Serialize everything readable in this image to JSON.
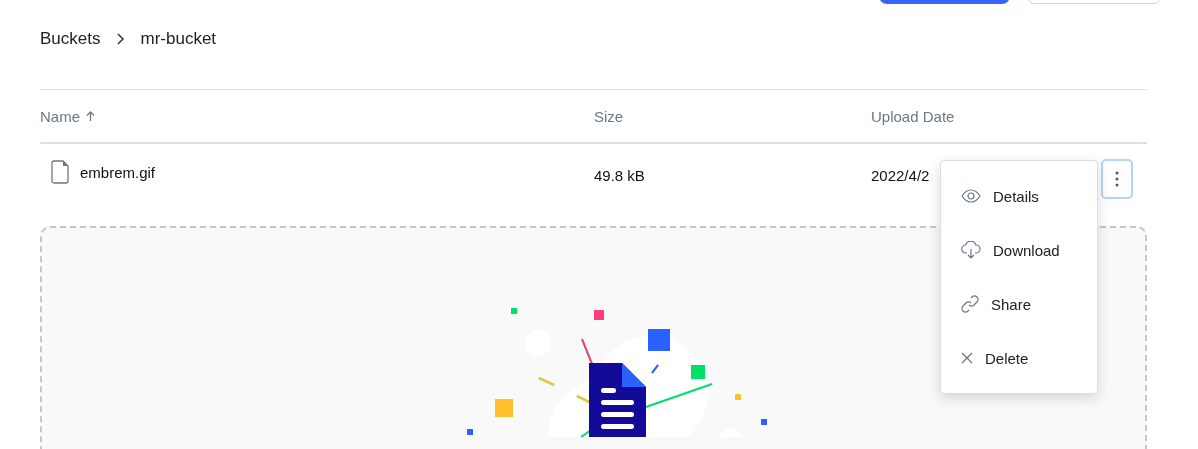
{
  "toolbar_buttons": [
    {
      "kind": "primary"
    },
    {
      "kind": "secondary"
    }
  ],
  "breadcrumb": [
    "Buckets",
    "mr-bucket"
  ],
  "table": {
    "columns": [
      {
        "label": "Name",
        "sorted": true
      },
      {
        "label": "Size",
        "sorted": false
      },
      {
        "label": "Upload Date",
        "sorted": false
      }
    ],
    "rows": [
      {
        "name": "embrem.gif",
        "size": "49.8 kB",
        "date": "2022/4/2"
      }
    ]
  },
  "row_menu": {
    "open": true,
    "items": [
      {
        "kind": "eye",
        "label": "Details"
      },
      {
        "kind": "download",
        "label": "Download"
      },
      {
        "kind": "link",
        "label": "Share"
      },
      {
        "kind": "close",
        "label": "Delete"
      }
    ]
  },
  "drop_zone": {
    "kind": "empty-state"
  }
}
